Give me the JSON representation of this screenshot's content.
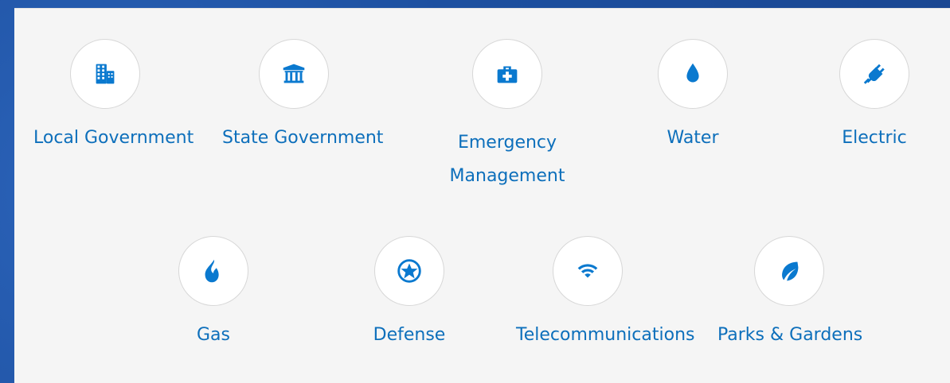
{
  "categories": [
    {
      "id": "local-government",
      "label": "Local Government",
      "icon": "building-icon"
    },
    {
      "id": "state-government",
      "label": "State Government",
      "icon": "bank-icon"
    },
    {
      "id": "emergency-management",
      "label": "Emergency Management",
      "icon": "medical-kit-icon"
    },
    {
      "id": "water",
      "label": "Water",
      "icon": "water-drop-icon"
    },
    {
      "id": "electric",
      "label": "Electric",
      "icon": "plug-icon"
    },
    {
      "id": "gas",
      "label": "Gas",
      "icon": "flame-icon"
    },
    {
      "id": "defense",
      "label": "Defense",
      "icon": "star-icon"
    },
    {
      "id": "telecommunications",
      "label": "Telecommunications",
      "icon": "wifi-icon"
    },
    {
      "id": "parks-gardens",
      "label": "Parks & Gardens",
      "icon": "leaf-icon"
    }
  ],
  "colors": {
    "accent": "#0a79cf",
    "label": "#0d6fbb",
    "panel": "#f5f5f5",
    "frame": "#1d50a0"
  }
}
